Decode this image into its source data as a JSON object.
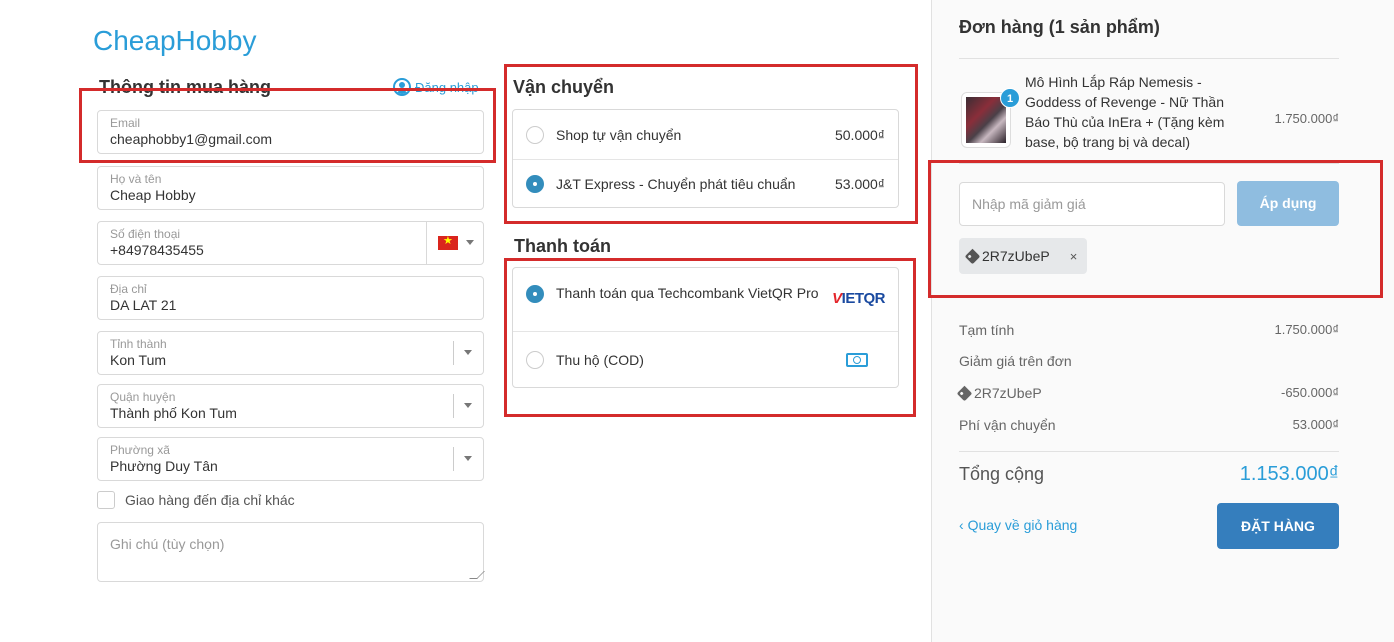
{
  "brand": {
    "logo": "CheapHobby"
  },
  "customer": {
    "title": "Thông tin mua hàng",
    "login": "Đăng nhập",
    "email": {
      "label": "Email",
      "value": "cheaphobby1@gmail.com"
    },
    "name": {
      "label": "Họ và tên",
      "value": "Cheap Hobby"
    },
    "phone": {
      "label": "Số điện thoại",
      "value": "+84978435455"
    },
    "address": {
      "label": "Địa chỉ",
      "value": "DA LAT 21"
    },
    "province": {
      "label": "Tỉnh thành",
      "value": "Kon Tum"
    },
    "district": {
      "label": "Quận huyện",
      "value": "Thành phố Kon Tum"
    },
    "ward": {
      "label": "Phường xã",
      "value": "Phường Duy Tân"
    },
    "ship_other": "Giao hàng đến địa chỉ khác",
    "note_placeholder": "Ghi chú (tùy chọn)"
  },
  "shipping": {
    "title": "Vận chuyển",
    "options": [
      {
        "label": "Shop tự vận chuyển",
        "price": "50.000₫",
        "selected": false
      },
      {
        "label": "J&T Express - Chuyển phát tiêu chuẩn",
        "price": "53.000₫",
        "selected": true
      }
    ]
  },
  "payment": {
    "title": "Thanh toán",
    "options": [
      {
        "label": "Thanh toán qua Techcombank VietQR Pro",
        "logo_v": "V",
        "logo_rest": "IET",
        "logo_qr": "QR",
        "selected": true
      },
      {
        "label": "Thu hộ (COD)",
        "icon": "cash-icon",
        "selected": false
      }
    ]
  },
  "order": {
    "title": "Đơn hàng (1 sản phẩm)",
    "product": {
      "quantity": "1",
      "name": "Mô Hình Lắp Ráp Nemesis - Goddess of Revenge - Nữ Thần Báo Thù của InEra + (Tặng kèm base, bộ trang bị và decal)",
      "price": "1.750.000₫"
    },
    "coupon": {
      "placeholder": "Nhập mã giảm giá",
      "apply": "Áp dụng",
      "applied_code": "2R7zUbeP",
      "remove": "×"
    },
    "summary": {
      "subtotal_label": "Tạm tính",
      "subtotal": "1.750.000₫",
      "discount_label": "Giảm giá trên đơn",
      "discount_code": "2R7zUbeP",
      "discount": "-650.000₫",
      "shipping_label": "Phí vận chuyển",
      "shipping": "53.000₫",
      "total_label": "Tổng cộng",
      "total": "1.153.000₫"
    },
    "back": "Quay về giỏ hàng",
    "place_order": "ĐẶT HÀNG"
  },
  "colors": {
    "accent": "#2a9dd8",
    "button": "#357ebd",
    "annotation": "#d42b2b"
  }
}
